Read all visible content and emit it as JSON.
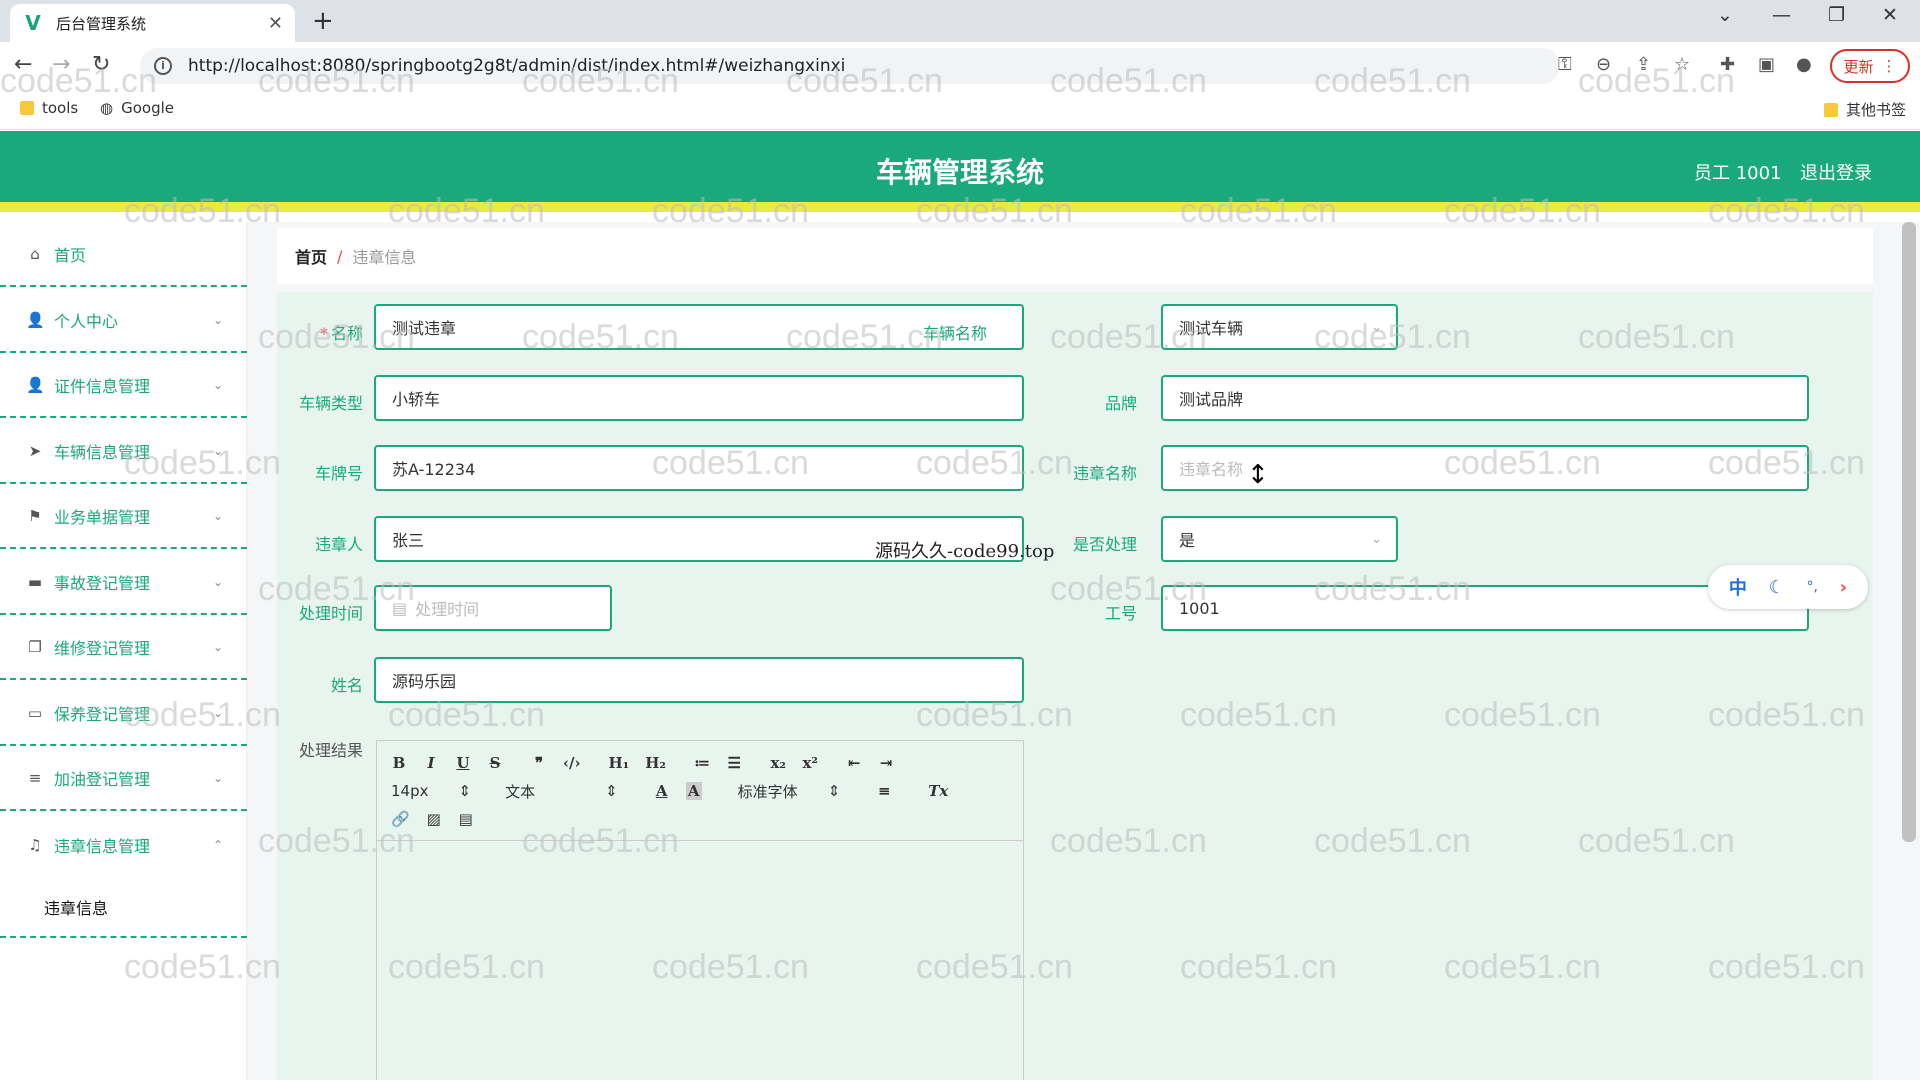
{
  "browser": {
    "tab_title": "后台管理系统",
    "url": "http://localhost:8080/springbootg2g8t/admin/dist/index.html#/weizhangxinxi",
    "update_label": "更新",
    "bookmarks": [
      "tools",
      "Google"
    ],
    "other_bookmarks": "其他书签"
  },
  "header": {
    "title": "车辆管理系统",
    "user": "员工 1001",
    "logout": "退出登录"
  },
  "sidebar": {
    "items": [
      {
        "label": "首页",
        "icon": "home-icon"
      },
      {
        "label": "个人中心",
        "icon": "user-icon"
      },
      {
        "label": "证件信息管理",
        "icon": "user-icon"
      },
      {
        "label": "车辆信息管理",
        "icon": "send-icon"
      },
      {
        "label": "业务单据管理",
        "icon": "flag-icon"
      },
      {
        "label": "事故登记管理",
        "icon": "car-icon"
      },
      {
        "label": "维修登记管理",
        "icon": "copy-icon"
      },
      {
        "label": "保养登记管理",
        "icon": "chat-icon"
      },
      {
        "label": "加油登记管理",
        "icon": "list-icon"
      },
      {
        "label": "违章信息管理",
        "icon": "bell-icon"
      }
    ],
    "submenu": "违章信息"
  },
  "breadcrumb": {
    "home": "首页",
    "separator": "/",
    "current": "违章信息"
  },
  "form": {
    "name_label": "名称",
    "name_value": "测试违章",
    "vehicle_name_label": "车辆名称",
    "vehicle_name_value": "测试车辆",
    "vehicle_type_label": "车辆类型",
    "vehicle_type_value": "小轿车",
    "brand_label": "品牌",
    "brand_value": "测试品牌",
    "plate_label": "车牌号",
    "plate_value": "苏A-12234",
    "violation_name_label": "违章名称",
    "violation_name_placeholder": "违章名称",
    "violator_label": "违章人",
    "violator_value": "张三",
    "handled_label": "是否处理",
    "handled_value": "是",
    "handle_time_label": "处理时间",
    "handle_time_placeholder": "处理时间",
    "employee_no_label": "工号",
    "employee_no_value": "1001",
    "person_name_label": "姓名",
    "person_name_value": "源码乐园",
    "result_label": "处理结果"
  },
  "editor": {
    "font_size": "14px",
    "paragraph": "文本",
    "font_family": "标准字体"
  },
  "overlay": {
    "center_watermark": "源码久久-code99.top",
    "watermark": "code51.cn",
    "float_zh": "中"
  }
}
